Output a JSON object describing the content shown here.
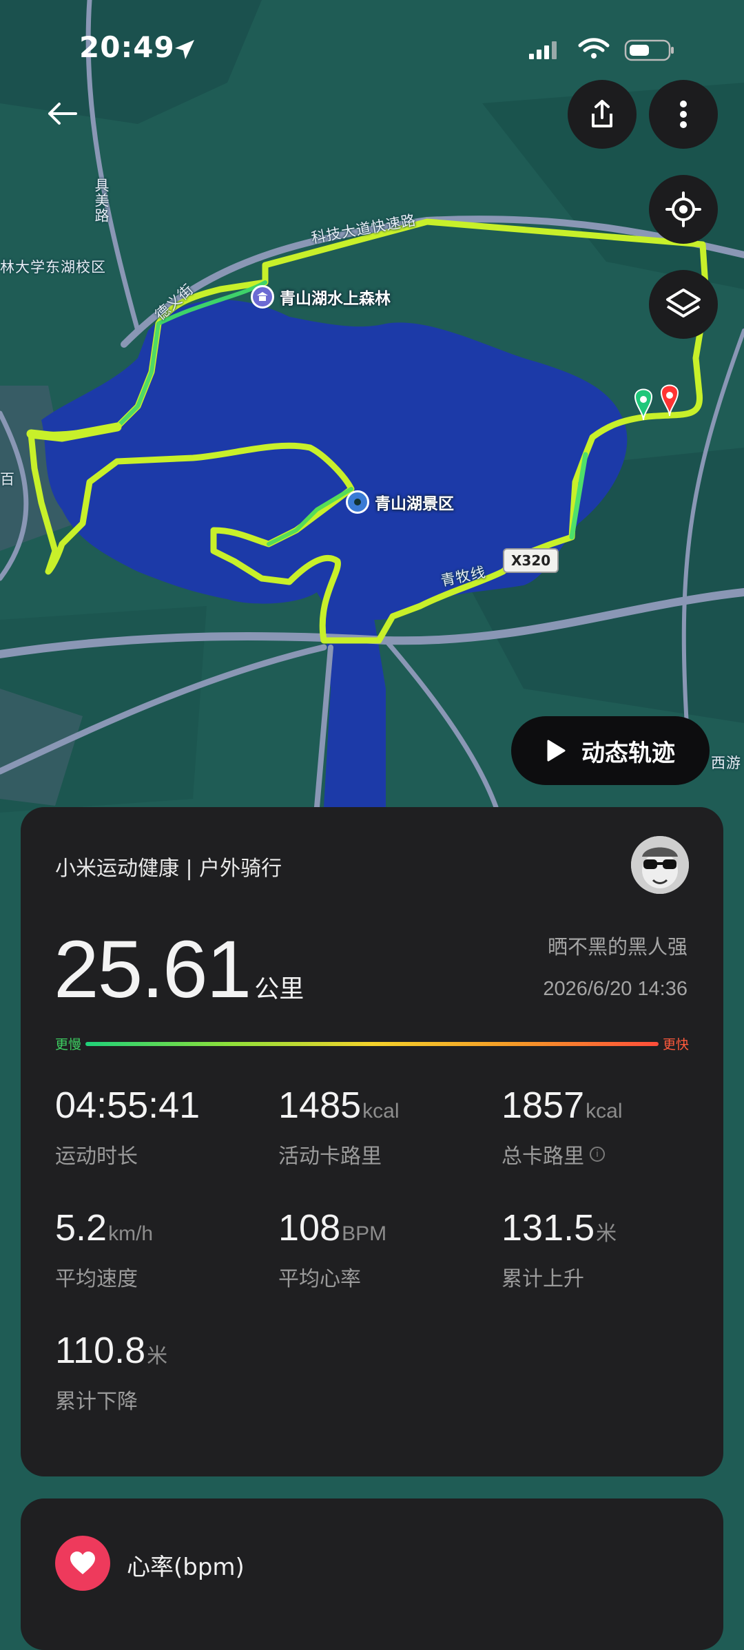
{
  "status_bar": {
    "time": "20:49"
  },
  "map": {
    "labels": {
      "juye_road": "具美路",
      "campus": "林大学东湖校区",
      "keji_expressway": "科技大道快速路",
      "deyi_street": "德义街",
      "qingmu_line": "青牧线",
      "bai": "百",
      "xiyou": "西游"
    },
    "pois": {
      "forest": "青山湖水上森林",
      "scenic": "青山湖景区"
    },
    "road_tag": "X320"
  },
  "controls": {
    "play_label": "动态轨迹"
  },
  "summary": {
    "app_title": "小米运动健康 | 户外骑行",
    "distance": "25.61",
    "distance_unit": "公里",
    "user_name": "晒不黑的黑人强",
    "datetime": "2026/6/20 14:36",
    "pace_slow": "更慢",
    "pace_fast": "更快",
    "stats": [
      {
        "value": "04:55:41",
        "unit": "",
        "label": "运动时长"
      },
      {
        "value": "1485",
        "unit": "kcal",
        "label": "活动卡路里"
      },
      {
        "value": "1857",
        "unit": "kcal",
        "label": "总卡路里"
      },
      {
        "value": "5.2",
        "unit": "km/h",
        "label": "平均速度"
      },
      {
        "value": "108",
        "unit": "BPM",
        "label": "平均心率"
      },
      {
        "value": "131.5",
        "unit": "米",
        "label": "累计上升"
      },
      {
        "value": "110.8",
        "unit": "米",
        "label": "累计下降"
      }
    ]
  },
  "heart_card": {
    "title": "心率(bpm)"
  },
  "colors": {
    "lake": "#1c3aa8",
    "land": "#1f5c55",
    "track": "#c8f02a",
    "card": "#1f1f21",
    "heart": "#ee3a5c"
  }
}
